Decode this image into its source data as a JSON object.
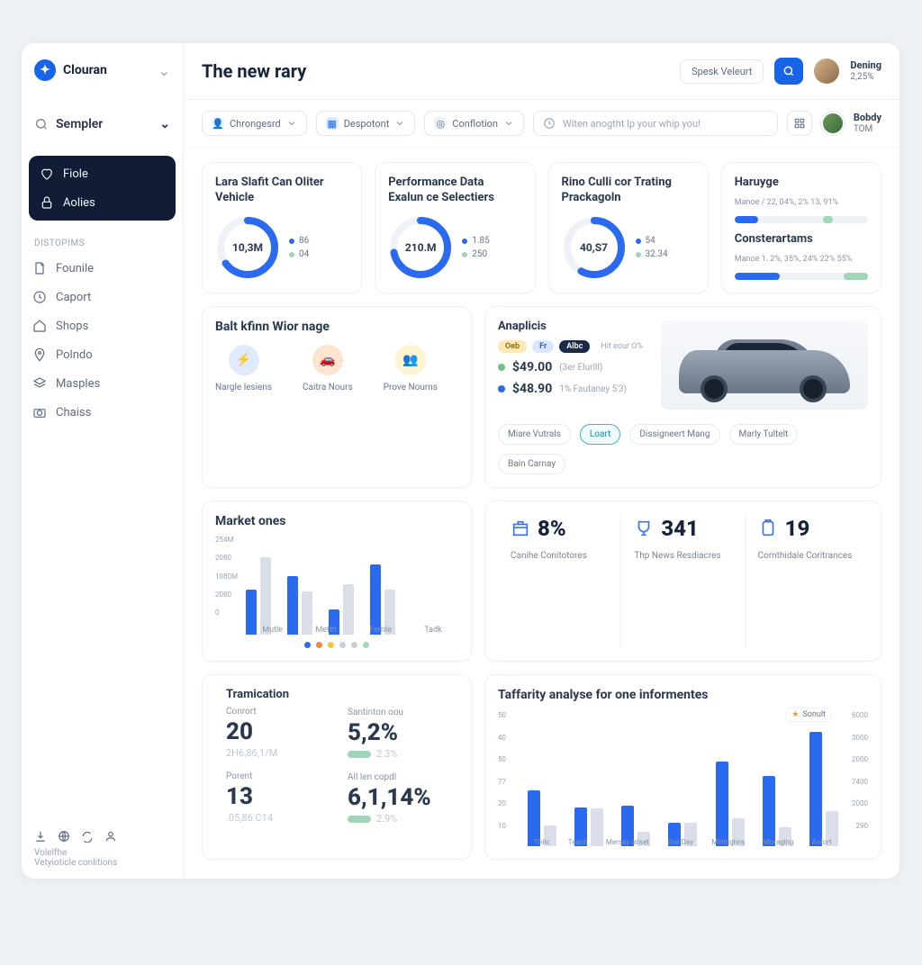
{
  "brand": "Clouran",
  "sidebar": {
    "search": "Sempler",
    "active": [
      {
        "icon": "heart",
        "label": "Fiole"
      },
      {
        "icon": "lock",
        "label": "Aolies"
      }
    ],
    "section": "DISTOPIMS",
    "items": [
      {
        "icon": "doc",
        "label": "Founile"
      },
      {
        "icon": "clock",
        "label": "Caport"
      },
      {
        "icon": "home",
        "label": "Shops"
      },
      {
        "icon": "pin",
        "label": "Polndo"
      },
      {
        "icon": "layers",
        "label": "Masples"
      },
      {
        "icon": "camera",
        "label": "Chaiss"
      }
    ],
    "footer1": "Volelfhe",
    "footer2": "Vetyioticle conlitions"
  },
  "header": {
    "title": "The new rary",
    "cta": "Spesk Veleurt",
    "user_name": "Dening",
    "user_sub": "2,25%"
  },
  "filters": {
    "f1": "Chrongesrd",
    "f2": "Despotont",
    "f3": "Conflotion",
    "search_ph": "Witen anogtht lp your whip you!",
    "user2": "Bobdy",
    "user2_sub": "TOM"
  },
  "kpis": [
    {
      "title": "Lara Slafit Can Oliter Vehicle",
      "center": "10,3M",
      "pct": 65,
      "legend": [
        {
          "c": "#2a6af0",
          "v": "86"
        },
        {
          "c": "#9fd6b8",
          "v": "04"
        }
      ]
    },
    {
      "title": "Performance Data Exalun ce Selectiers",
      "center": "210.M",
      "pct": 72,
      "legend": [
        {
          "c": "#2a6af0",
          "v": "1.85"
        },
        {
          "c": "#9fd6b8",
          "v": "250"
        }
      ]
    },
    {
      "title": "Rino Culli cor Trating Prackagoln",
      "center": "40,S7",
      "pct": 58,
      "legend": [
        {
          "c": "#2a6af0",
          "v": "54"
        },
        {
          "c": "#9fd6b8",
          "v": "32.34"
        }
      ]
    }
  ],
  "haruge": {
    "title": "Haruyge",
    "sub": "Manoe / 22, 04%, 2% 13, 91%",
    "bars": [
      {
        "c": "#2a6af0",
        "w": 18
      },
      {
        "c": "#9fd6b8",
        "w": 8
      }
    ],
    "title2": "Consterartams",
    "sub2": "Manoe 1. 2%, 35%, 24% 22% 55%",
    "bars2": [
      {
        "c": "#2a6af0",
        "w": 34
      },
      {
        "c": "#9fd6b8",
        "w": 20
      }
    ]
  },
  "workage": {
    "title": "Balt kfinn Wior nage",
    "items": [
      {
        "c": "#dfeaff",
        "fg": "#1a6af0",
        "icon": "bolt",
        "label": "Nargle lesiens"
      },
      {
        "c": "#ffe5cf",
        "fg": "#e07a1a",
        "icon": "car",
        "label": "Caitra Nours"
      },
      {
        "c": "#fff4cf",
        "fg": "#c9a20a",
        "icon": "people",
        "label": "Prove Nourns"
      }
    ]
  },
  "anal": {
    "title": "Anaplicis",
    "pills": [
      {
        "t": "Oeb",
        "bg": "#ffe9b3",
        "fg": "#8a6a10"
      },
      {
        "t": "Fr",
        "bg": "#d8e6ff",
        "fg": "#2a58c0"
      },
      {
        "t": "Albc",
        "bg": "#1a2a4a",
        "fg": "#fff"
      }
    ],
    "pill_note": "Hit eour O%",
    "p1": {
      "dot": "#72c28a",
      "val": "$49.00",
      "note": "(3er Elurlll)"
    },
    "p2": {
      "dot": "#2a6af0",
      "val": "$48.90",
      "note": "1% Fautaney 5'3)"
    },
    "tabs": [
      "Miare Vutrals",
      "Loart",
      "Dissigneert Mang",
      "Marly Tultelt",
      "Bain Carnay"
    ],
    "tab_on": 1
  },
  "stats3": [
    {
      "icon": "box",
      "val": "8%",
      "label": "Canihe Conitotores"
    },
    {
      "icon": "cup",
      "val": "341",
      "label": "Thp News Resdiacres"
    },
    {
      "icon": "clip",
      "val": "19",
      "label": "Comthidale Coritrances"
    }
  ],
  "trans": {
    "title": "Tramication",
    "l1": "Conrort",
    "v1": "20",
    "s1": "2H6,86,1/M",
    "l2": "Santinton oou",
    "v2": "5,2%",
    "b2": "#9fd6b8",
    "p2": "2.3%",
    "l3": "Porent",
    "v3": "13",
    "s3": ".05,86 C14",
    "l4": "All len copdl",
    "v4": "6,1,14%",
    "b4": "#9fd6b8",
    "p4": "2.9%"
  },
  "analyse_title": "Taffarity analyse for one informentes",
  "analyse_legend": "Sonult",
  "chart_data": [
    {
      "type": "bar",
      "title": "Market ones",
      "ylabels": [
        "254M",
        "2080",
        "1080M",
        "2080",
        "0"
      ],
      "categories": [
        "Mutle",
        "Metth",
        "Femle",
        "Tadk"
      ],
      "series": [
        {
          "name": "blue",
          "color": "#2a6af0",
          "values": [
            50,
            65,
            28,
            78
          ]
        },
        {
          "name": "grey",
          "color": "#d9dee8",
          "values": [
            86,
            48,
            56,
            50
          ]
        }
      ],
      "dots": [
        "#2a6af0",
        "#f0883a",
        "#f0c83a",
        "#c9cfd9",
        "#c9cfd9",
        "#9fd6b8"
      ]
    },
    {
      "type": "bar",
      "title": "Taffarity analyse for one informentes",
      "yl": [
        "50",
        "40",
        "50",
        "77",
        "20",
        "10"
      ],
      "yr": [
        "6000",
        "3000",
        "2000",
        "7400",
        "2000",
        "290"
      ],
      "categories": [
        "Thilc",
        "Teanh",
        "Mersay latset",
        "Dve Day",
        "Minitighns",
        "Moraging",
        "Aolort"
      ],
      "series": [
        {
          "name": "blue",
          "color": "#2a6af0",
          "values": [
            48,
            33,
            35,
            20,
            72,
            60,
            98
          ]
        },
        {
          "name": "grey",
          "color": "#d9dee8",
          "values": [
            18,
            32,
            12,
            20,
            24,
            16,
            30
          ]
        }
      ]
    }
  ]
}
